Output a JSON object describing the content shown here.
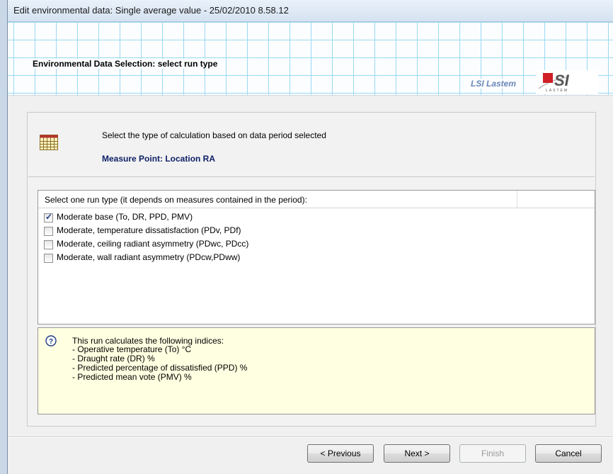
{
  "window": {
    "title": "Edit environmental data: Single average value - 25/02/2010 8.58.12"
  },
  "header": {
    "title": "Environmental Data Selection: select run type",
    "brand": "LSI Lastem",
    "logo_text": "LSI",
    "logo_subtext": "LASTEM"
  },
  "main": {
    "instruction": "Select the type of calculation based on data period selected",
    "measure_point": "Measure Point: Location RA",
    "list": {
      "header": "Select one run type (it depends on measures contained in the period):",
      "options": [
        {
          "label": "Moderate base (To, DR, PPD, PMV)",
          "checked": true
        },
        {
          "label": "Moderate, temperature dissatisfaction (PDv, PDf)",
          "checked": false
        },
        {
          "label": "Moderate, ceiling radiant asymmetry (PDwc, PDcc)",
          "checked": false
        },
        {
          "label": "Moderate, wall radiant asymmetry (PDcw,PDww)",
          "checked": false
        }
      ]
    },
    "info": {
      "title": "This run calculates the following indices:",
      "items": [
        "- Operative temperature (To) °C",
        "- Draught rate (DR) %",
        "- Predicted percentage of dissatisfied (PPD) %",
        "- Predicted mean vote (PMV) %"
      ]
    }
  },
  "footer": {
    "previous": "< Previous",
    "next": "Next >",
    "finish": "Finish",
    "cancel": "Cancel"
  },
  "icons": {
    "grid": "calendar-grid-icon",
    "help": "question-icon"
  },
  "colors": {
    "header_grid": "#9bd9f2",
    "info_bg": "#ffffe1",
    "measure_point": "#0d1f66",
    "logo_red": "#d01f26"
  }
}
